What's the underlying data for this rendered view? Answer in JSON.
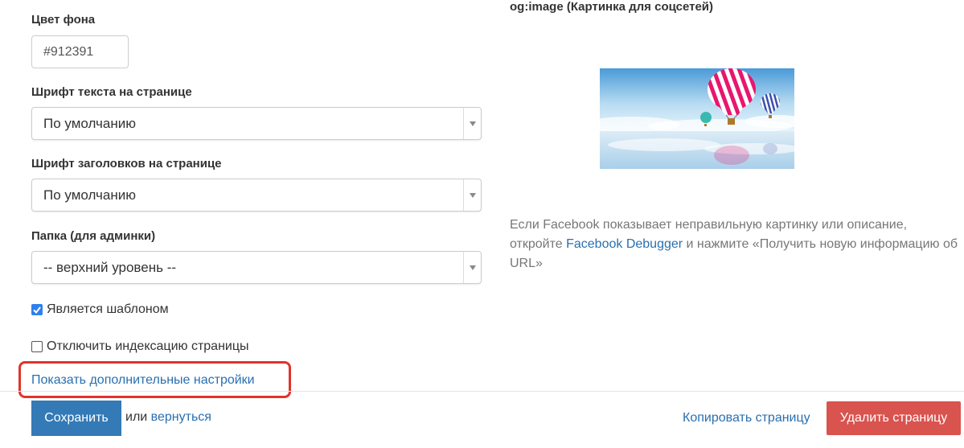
{
  "form": {
    "bg_color_label": "Цвет фона",
    "bg_color_value": "#912391",
    "page_font_label": "Шрифт текста на странице",
    "page_font_value": "По умолчанию",
    "heading_font_label": "Шрифт заголовков на странице",
    "heading_font_value": "По умолчанию",
    "folder_label": "Папка (для админки)",
    "folder_value": "-- верхний уровень --",
    "is_template_label": "Является шаблоном",
    "is_template_checked": true,
    "noindex_label": "Отключить индексацию страницы",
    "noindex_checked": false,
    "advanced_link": "Показать дополнительные настройки"
  },
  "og": {
    "title": "og:image (Картинка для соцсетей)",
    "image_name": "hot-air-balloons-image",
    "desc_before": "Если Facebook показывает неправильную картинку или описание, откройте ",
    "desc_link": "Facebook Debugger",
    "desc_after": " и нажмите «Получить новую информацию об URL»"
  },
  "footer": {
    "save": "Сохранить",
    "or": "или",
    "back": "вернуться",
    "copy": "Копировать страницу",
    "delete": "Удалить страницу"
  },
  "colors": {
    "primary": "#337ab7",
    "danger": "#d9534f",
    "link": "#2a6fb0",
    "highlight": "#e0342a",
    "checkbox": "#2f80ed"
  }
}
